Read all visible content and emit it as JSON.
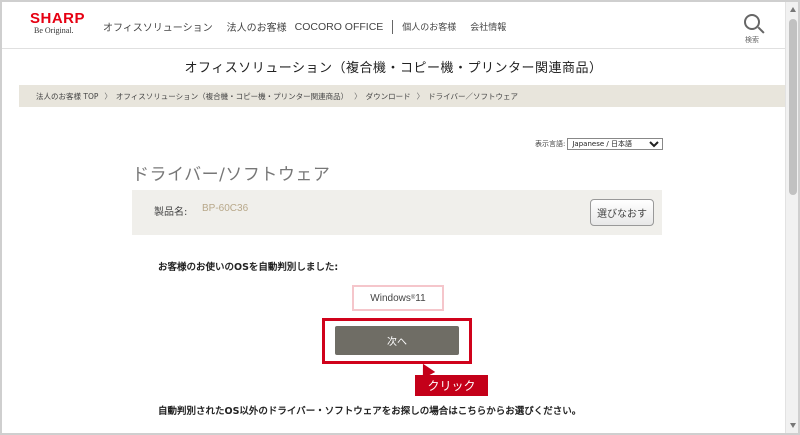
{
  "header": {
    "logo_text": "SHARP",
    "logo_tagline": "Be Original.",
    "nav": [
      {
        "label": "オフィスソリューション"
      },
      {
        "label": "法人のお客様"
      },
      {
        "label": "COCORO OFFICE"
      },
      {
        "label": "個人のお客様"
      },
      {
        "label": "会社情報"
      }
    ],
    "search_label": "検索"
  },
  "category_title": "オフィスソリューション（複合機・コピー機・プリンター関連商品）",
  "breadcrumb": [
    {
      "label": "法人のお客様 TOP"
    },
    {
      "label": "オフィスソリューション（複合機・コピー機・プリンター関連商品）"
    },
    {
      "label": "ダウンロード"
    },
    {
      "label": "ドライバー／ソフトウェア"
    }
  ],
  "language": {
    "label": "表示言語:",
    "selected": "Japanese / 日本語"
  },
  "page_title": "ドライバー/ソフトウェア",
  "product": {
    "label": "製品名:",
    "value": "BP-60C36",
    "reselect_label": "選びなおす"
  },
  "os_detect_message": "お客様のお使いのOSを自動判別しました:",
  "detected_os": {
    "name": "Windows",
    "mark": "®",
    "version": " 11"
  },
  "next_button_label": "次へ",
  "callout_label": "クリック",
  "other_os_message": "自動判別されたOS以外のドライバー・ソフトウェアをお探しの場合はこちらからお選びください。",
  "colors": {
    "brand": "#e60012",
    "highlight": "#d0021b",
    "button": "#6f6d65",
    "breadcrumb_bg": "#e8e5dc"
  }
}
